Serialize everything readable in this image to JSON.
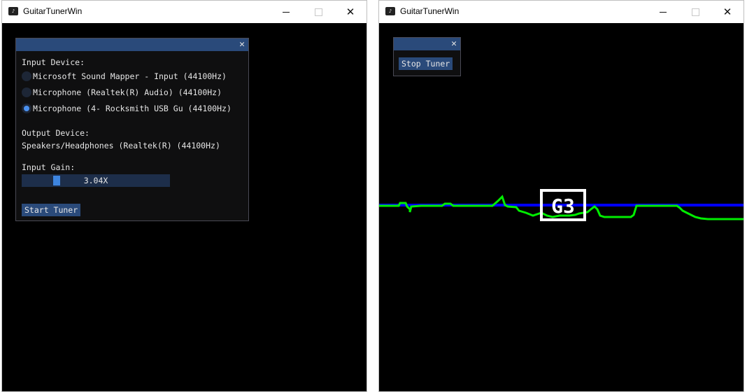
{
  "left_window": {
    "title": "GuitarTunerWin",
    "controls": {
      "minimize": "—",
      "maximize": "☐",
      "close": "✕"
    },
    "panel": {
      "close_glyph": "✕",
      "input_device_label": "Input Device:",
      "devices": [
        {
          "label": "Microsoft Sound Mapper - Input (44100Hz)",
          "selected": false
        },
        {
          "label": "Microphone (Realtek(R) Audio) (44100Hz)",
          "selected": false
        },
        {
          "label": "Microphone (4- Rocksmith USB Gu (44100Hz)",
          "selected": true
        }
      ],
      "output_device_label": "Output Device:",
      "output_device_value": "Speakers/Headphones (Realtek(R) (44100Hz)",
      "input_gain_label": "Input Gain:",
      "input_gain_value": "3.04X",
      "start_button": "Start Tuner"
    }
  },
  "right_window": {
    "title": "GuitarTunerWin",
    "controls": {
      "minimize": "—",
      "maximize": "☐",
      "close": "✕"
    },
    "panel": {
      "close_glyph": "✕",
      "stop_button": "Stop Tuner"
    },
    "tuner_display": {
      "note": "G3",
      "reference_line_color": "#0000ff",
      "signal_line_color": "#00ee00",
      "note_color": "#ffffff"
    }
  },
  "colors": {
    "panel_title": "#2a4a7a",
    "button": "#2a4a7a",
    "slider_bg": "#1d2e4a",
    "slider_grab": "#3d85e0",
    "radio_on": "#4a90ee"
  }
}
